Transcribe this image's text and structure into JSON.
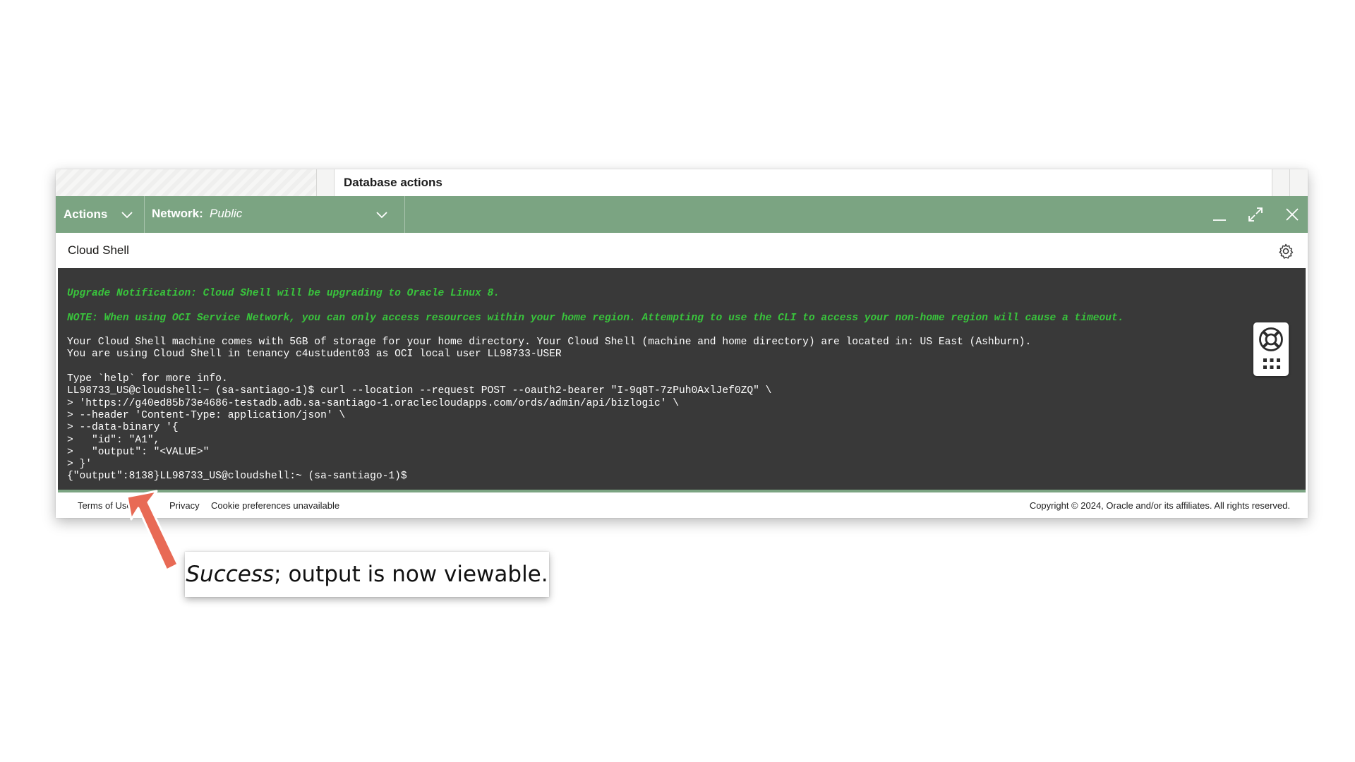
{
  "topbar": {
    "title": "Database actions"
  },
  "toolbar": {
    "actions_label": "Actions",
    "network_label": "Network:",
    "network_value": "Public"
  },
  "shell": {
    "title": "Cloud Shell"
  },
  "terminal": {
    "lines": [
      {
        "text": "Upgrade Notification: Cloud Shell will be upgrading to Oracle Linux 8.",
        "style": "notice"
      },
      {
        "text": "",
        "style": ""
      },
      {
        "text": "NOTE: When using OCI Service Network, you can only access resources within your home region. Attempting to use the CLI to access your non-home region will cause a timeout.",
        "style": "notice"
      },
      {
        "text": "",
        "style": ""
      },
      {
        "text": "Your Cloud Shell machine comes with 5GB of storage for your home directory. Your Cloud Shell (machine and home directory) are located in: US East (Ashburn).",
        "style": ""
      },
      {
        "text": "You are using Cloud Shell in tenancy c4ustudent03 as OCI local user LL98733-USER",
        "style": ""
      },
      {
        "text": "",
        "style": ""
      },
      {
        "text": "Type `help` for more info.",
        "style": ""
      },
      {
        "text": "LL98733_US@cloudshell:~ (sa-santiago-1)$ curl --location --request POST --oauth2-bearer \"I-9q8T-7zPuh0AxlJef0ZQ\" \\",
        "style": ""
      },
      {
        "text": "> 'https://g40ed85b73e4686-testadb.adb.sa-santiago-1.oraclecloudapps.com/ords/admin/api/bizlogic' \\",
        "style": ""
      },
      {
        "text": "> --header 'Content-Type: application/json' \\",
        "style": ""
      },
      {
        "text": "> --data-binary '{",
        "style": ""
      },
      {
        "text": ">   \"id\": \"A1\",",
        "style": ""
      },
      {
        "text": ">   \"output\": \"<VALUE>\"",
        "style": ""
      },
      {
        "text": "> }'",
        "style": ""
      },
      {
        "text": "{\"output\":8138}LL98733_US@cloudshell:~ (sa-santiago-1)$",
        "style": ""
      }
    ]
  },
  "footer": {
    "terms": "Terms of Use",
    "privacy": "Privacy",
    "cookie": "Cookie preferences unavailable",
    "copyright": "Copyright © 2024, Oracle and/or its affiliates. All rights reserved."
  },
  "callout": {
    "emphasis": "Success",
    "rest": "; output is now viewable."
  },
  "icons": {
    "actions_chevron": "chevron-down-icon",
    "network_chevron": "chevron-down-icon",
    "minimize": "minimize-icon",
    "maximize": "maximize-icon",
    "close": "close-icon",
    "settings": "gear-icon",
    "help": "lifebuoy-icon",
    "apps": "grid-icon"
  },
  "colors": {
    "toolbar": "#7ba482",
    "terminal_bg": "#393939",
    "notice_text": "#39c43c",
    "arrow": "#e86a55"
  }
}
